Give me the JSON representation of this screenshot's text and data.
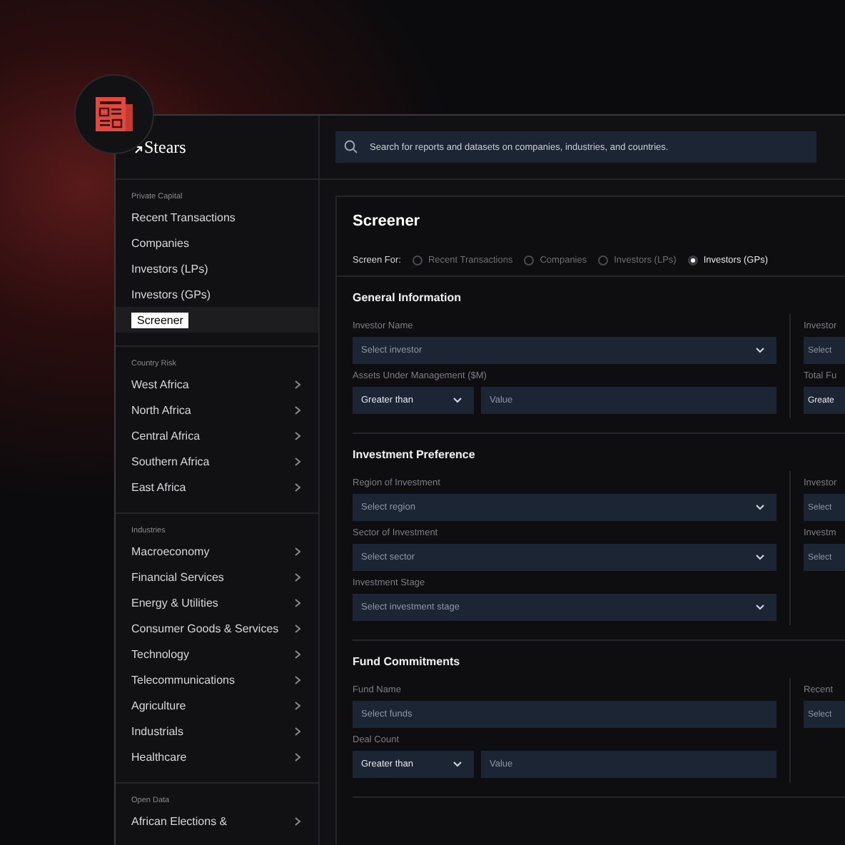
{
  "brand": "Stears",
  "search": {
    "placeholder": "Search for reports and datasets on companies, industries, and countries."
  },
  "sidebar": {
    "sections": [
      {
        "title": "Private Capital",
        "items": [
          {
            "label": "Recent Transactions",
            "selected": false,
            "expandable": false
          },
          {
            "label": "Companies",
            "selected": false,
            "expandable": false
          },
          {
            "label": "Investors (LPs)",
            "selected": false,
            "expandable": false
          },
          {
            "label": "Investors (GPs)",
            "selected": false,
            "expandable": false
          },
          {
            "label": "Screener",
            "selected": true,
            "expandable": false
          }
        ]
      },
      {
        "title": "Country Risk",
        "items": [
          {
            "label": "West Africa",
            "selected": false,
            "expandable": true
          },
          {
            "label": "North Africa",
            "selected": false,
            "expandable": true
          },
          {
            "label": "Central Africa",
            "selected": false,
            "expandable": true
          },
          {
            "label": "Southern Africa",
            "selected": false,
            "expandable": true
          },
          {
            "label": "East Africa",
            "selected": false,
            "expandable": true
          }
        ]
      },
      {
        "title": "Industries",
        "items": [
          {
            "label": "Macroeconomy",
            "selected": false,
            "expandable": true
          },
          {
            "label": "Financial Services",
            "selected": false,
            "expandable": true
          },
          {
            "label": "Energy & Utilities",
            "selected": false,
            "expandable": true
          },
          {
            "label": "Consumer Goods & Services",
            "selected": false,
            "expandable": true
          },
          {
            "label": "Technology",
            "selected": false,
            "expandable": true
          },
          {
            "label": "Telecommunications",
            "selected": false,
            "expandable": true
          },
          {
            "label": "Agriculture",
            "selected": false,
            "expandable": true
          },
          {
            "label": "Industrials",
            "selected": false,
            "expandable": true
          },
          {
            "label": "Healthcare",
            "selected": false,
            "expandable": true
          }
        ]
      },
      {
        "title": "Open Data",
        "items": [
          {
            "label": "African Elections &",
            "selected": false,
            "expandable": true
          }
        ]
      }
    ]
  },
  "page": {
    "title": "Screener",
    "screen_for": {
      "label": "Screen For:",
      "options": [
        {
          "label": "Recent Transactions",
          "selected": false
        },
        {
          "label": "Companies",
          "selected": false
        },
        {
          "label": "Investors (LPs)",
          "selected": false
        },
        {
          "label": "Investors (GPs)",
          "selected": true
        }
      ]
    },
    "sections": [
      {
        "title": "General Information",
        "left": [
          {
            "label": "Investor Name",
            "kind": "select",
            "placeholder": "Select investor"
          },
          {
            "label": "Assets Under Management ($M)",
            "kind": "compare",
            "operator": "Greater than",
            "placeholder": "Value"
          }
        ],
        "right": [
          {
            "label": "Investor",
            "kind": "input",
            "placeholder": "Select"
          },
          {
            "label": "Total Fu",
            "kind": "input",
            "value": "Greate"
          }
        ]
      },
      {
        "title": "Investment Preference",
        "left": [
          {
            "label": "Region of Investment",
            "kind": "select",
            "placeholder": "Select region"
          },
          {
            "label": "Sector of Investment",
            "kind": "select",
            "placeholder": "Select sector"
          },
          {
            "label": "Investment Stage",
            "kind": "select",
            "placeholder": "Select investment stage"
          }
        ],
        "right": [
          {
            "label": "Investor",
            "kind": "input",
            "placeholder": "Select"
          },
          {
            "label": "Investm",
            "kind": "input",
            "placeholder": "Select"
          }
        ]
      },
      {
        "title": "Fund Commitments",
        "left": [
          {
            "label": "Fund Name",
            "kind": "input",
            "placeholder": "Select funds"
          },
          {
            "label": "Deal Count",
            "kind": "compare",
            "operator": "Greater than",
            "placeholder": "Value"
          }
        ],
        "right": [
          {
            "label": "Recent",
            "kind": "input",
            "placeholder": "Select"
          }
        ]
      }
    ]
  }
}
